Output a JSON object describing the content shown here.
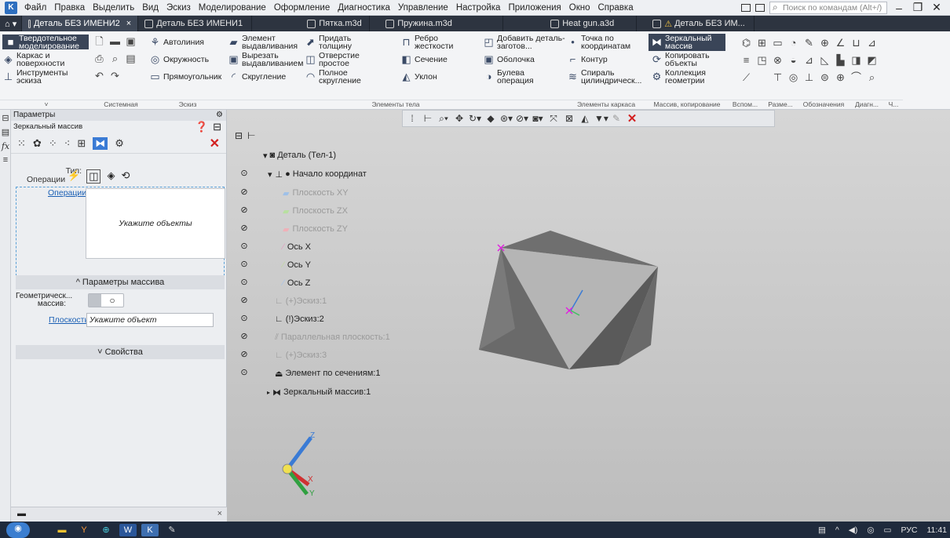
{
  "menubar": {
    "items": [
      "Файл",
      "Правка",
      "Выделить",
      "Вид",
      "Эскиз",
      "Моделирование",
      "Оформление",
      "Диагностика",
      "Управление",
      "Настройка",
      "Приложения",
      "Окно",
      "Справка"
    ],
    "search_placeholder": "Поиск по командам (Alt+/)"
  },
  "tabs": [
    {
      "label": "Деталь БЕЗ ИМЕНИ2",
      "active": true,
      "close": "×"
    },
    {
      "label": "Деталь БЕЗ ИМЕНИ1",
      "active": false
    },
    {
      "label": "Пятка.m3d",
      "active": false
    },
    {
      "label": "Пружина.m3d",
      "active": false
    },
    {
      "label": "Heat gun.a3d",
      "active": false
    },
    {
      "label": "Деталь БЕЗ ИМ...",
      "active": false
    }
  ],
  "ribbon": {
    "left": {
      "solid": "Твердотельное моделирование",
      "wire": "Каркас и поверхности",
      "sketch_tools": "Инструменты эскиза"
    },
    "system": {
      "autoline": "Автолиния",
      "circle": "Окружность",
      "rectangle": "Прямоугольник"
    },
    "body": {
      "extrude": "Элемент выдавливания",
      "cut_extrude": "Вырезать выдавливанием",
      "fillet": "Скругление",
      "thicken": "Придать толщину",
      "hole": "Отверстие простое",
      "full_fillet": "Полное скругление",
      "rib": "Ребро жесткости",
      "section": "Сечение",
      "draft": "Уклон",
      "add_blank": "Добавить деталь-заготов...",
      "shell": "Оболочка",
      "boolean": "Булева операция"
    },
    "frame": {
      "point": "Точка по координатам",
      "contour": "Контур",
      "spiral": "Спираль цилиндрическ..."
    },
    "copy": {
      "mirror": "Зеркальный массив",
      "copy_objects": "Копировать объекты",
      "geometry": "Коллекция геометрии"
    },
    "groups": [
      "Системная",
      "Эскиз",
      "Элементы тела",
      "Элементы каркаса",
      "Массив, копирование",
      "Вспом...",
      "Разме...",
      "Обозначения",
      "Диагн...",
      "Ч..."
    ]
  },
  "panel": {
    "header": "Параметры",
    "subtitle": "Зеркальный массив",
    "type_label": "Тип:",
    "type_value": "Операции",
    "operations_link": "Операции",
    "objects_placeholder": "Укажите объекты",
    "array_params": "Параметры массива",
    "geometric_label": "Геометрическ... массив:",
    "plane_link": "Плоскость",
    "plane_placeholder": "Укажите объект",
    "properties": "Свойства"
  },
  "tree": {
    "root": "Деталь (Тел-1)",
    "origin": "Начало координат",
    "items": [
      {
        "label": "Плоскость XY",
        "faded": true
      },
      {
        "label": "Плоскость ZX",
        "faded": true
      },
      {
        "label": "Плоскость ZY",
        "faded": true
      },
      {
        "label": "Ось X",
        "faded": false
      },
      {
        "label": "Ось Y",
        "faded": false
      },
      {
        "label": "Ось Z",
        "faded": false
      },
      {
        "label": "(+)Эскиз:1",
        "faded": true
      },
      {
        "label": "(!)Эскиз:2",
        "faded": false
      },
      {
        "label": "Параллельная плоскость:1",
        "faded": true
      },
      {
        "label": "(+)Эскиз:3",
        "faded": true
      },
      {
        "label": "Элемент по сечениям:1",
        "faded": false
      }
    ],
    "mirror": "Зеркальный массив:1"
  },
  "axes": {
    "z": "Z",
    "x": "X",
    "y": "Y"
  },
  "taskbar": {
    "lang": "РУС",
    "time": "11:41"
  }
}
